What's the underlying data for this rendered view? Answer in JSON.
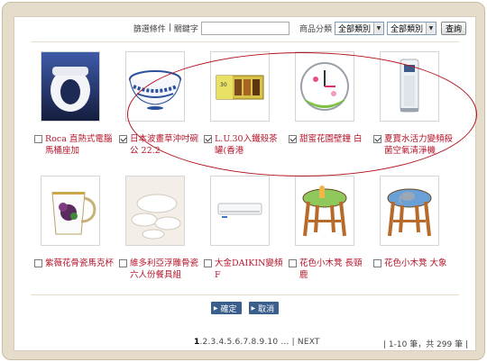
{
  "search": {
    "condition_label": "篩選條件",
    "separator": "|",
    "keyword_label": "關鍵字",
    "keyword_value": "",
    "category_label": "商品分類",
    "category_select_1": "全部類別",
    "category_select_2": "全部類別",
    "query_button": "查詢"
  },
  "products": [
    {
      "title": "Roca 直熱式電腦馬桶座加",
      "checked": false,
      "icon": "toilet-seat-image"
    },
    {
      "title": "日本波畫草沖吋碗公 22.2",
      "checked": true,
      "icon": "bowl-image"
    },
    {
      "title": "L.U.30入鐵殼茶罐(香港",
      "checked": true,
      "icon": "tea-tins-image"
    },
    {
      "title": "甜蜜花園壁鐘 白",
      "checked": true,
      "icon": "wall-clock-image"
    },
    {
      "title": "夏寶水活力變頻殺菌空氣清淨機",
      "checked": true,
      "icon": "air-purifier-image"
    },
    {
      "title": "紫薇花骨瓷馬克杯",
      "checked": false,
      "icon": "mug-image"
    },
    {
      "title": "維多利亞浮雕骨瓷六人份餐具組",
      "checked": false,
      "icon": "tableware-image"
    },
    {
      "title": "大金DAIKIN變頻F",
      "checked": false,
      "icon": "air-conditioner-image"
    },
    {
      "title": "花色小木凳 長頸鹿",
      "checked": false,
      "icon": "giraffe-stool-image"
    },
    {
      "title": "花色小木凳 大象",
      "checked": false,
      "icon": "elephant-stool-image"
    }
  ],
  "actions": {
    "confirm": "確定",
    "cancel": "取消"
  },
  "pager": {
    "current": "1",
    "pages": ".2.3.4.5.6.7.8.9.10 ...",
    "next": "| NEXT"
  },
  "total": "| 1-10 筆，共 299 筆 |",
  "colors": {
    "frame": "#e6dccb",
    "title_red": "#b5152b",
    "button_blue": "#3a5f8c",
    "highlight_oval": "#b3121e"
  }
}
